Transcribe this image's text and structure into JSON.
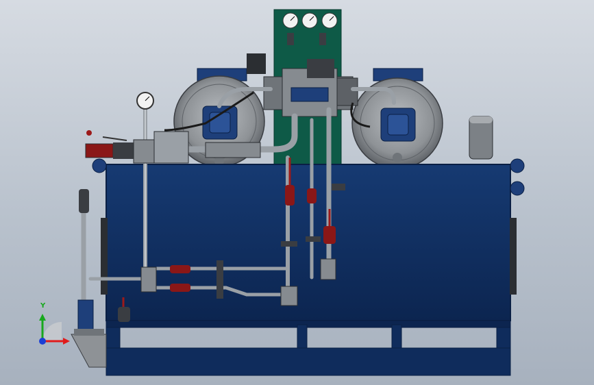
{
  "viewport": {
    "background_top": "#d6dbe2",
    "background_bottom": "#a7b1be"
  },
  "colors": {
    "tank_blue": "#0f2c5c",
    "tank_edge": "#0a1f44",
    "motor_gray": "#8e9296",
    "pump_blue": "#1e3f7a",
    "panel_green": "#0e5a47",
    "pipe_gray": "#9aa0a6",
    "valve_red": "#9c1a1a",
    "bracket_dark": "#3a3d42"
  },
  "triad": {
    "y_label": "Y",
    "x_color": "#e01b1b",
    "y_color": "#18a81e",
    "z_color": "#1b3fd6"
  },
  "icons": [
    "gauge-icon",
    "coordinate-triad-icon"
  ]
}
